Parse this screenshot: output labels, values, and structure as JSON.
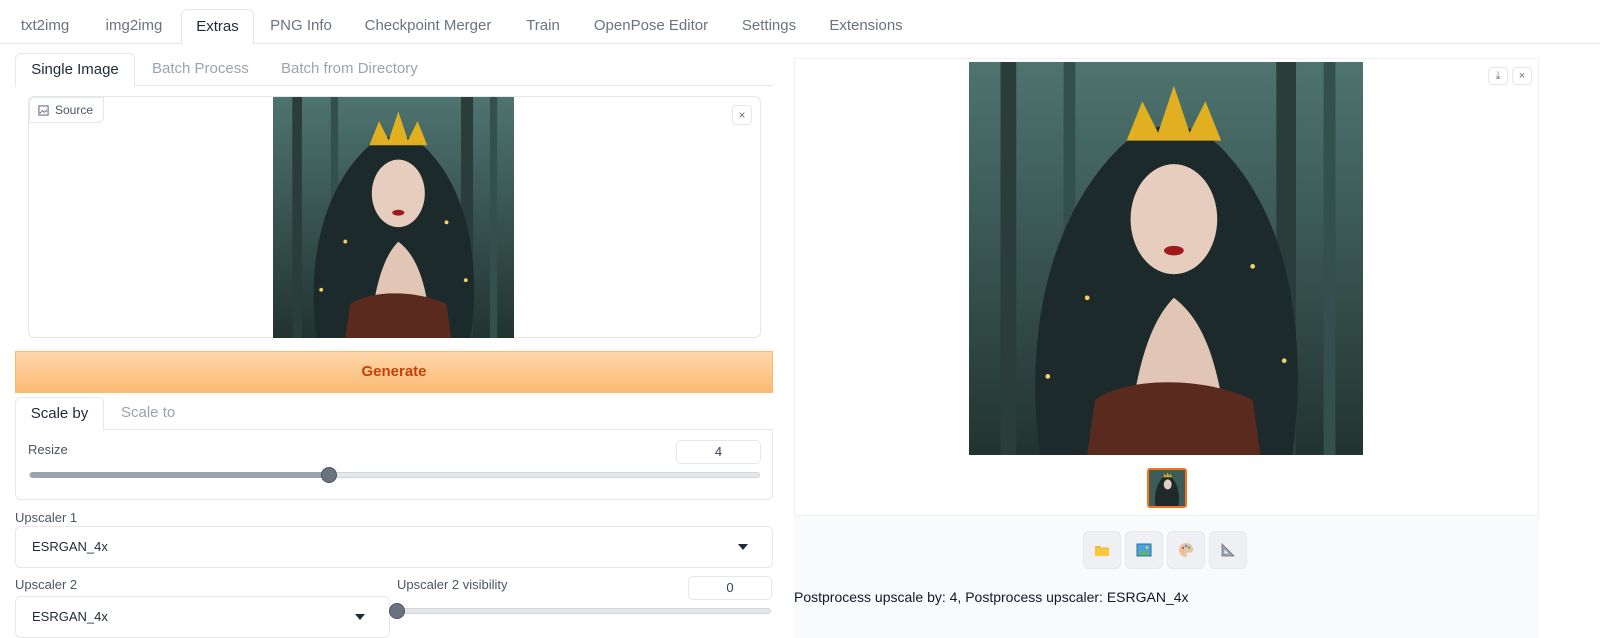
{
  "top_tabs": [
    "txt2img",
    "img2img",
    "Extras",
    "PNG Info",
    "Checkpoint Merger",
    "Train",
    "OpenPose Editor",
    "Settings",
    "Extensions"
  ],
  "active_top_tab": "Extras",
  "sub_tabs": [
    "Single Image",
    "Batch Process",
    "Batch from Directory"
  ],
  "source": {
    "label": "Source",
    "close": "×"
  },
  "generate_label": "Generate",
  "scale_tabs": [
    "Scale by",
    "Scale to"
  ],
  "resize": {
    "label": "Resize",
    "value": "4",
    "fraction": 0.41
  },
  "upscaler1": {
    "label": "Upscaler 1",
    "value": "ESRGAN_4x"
  },
  "upscaler2": {
    "label": "Upscaler 2",
    "value": "ESRGAN_4x"
  },
  "upscaler2_visibility": {
    "label": "Upscaler 2 visibility",
    "value": "0",
    "fraction": 0.0
  },
  "gallery": {
    "download": "⤓",
    "close": "×"
  },
  "actions": [
    "folder-icon",
    "image-icon",
    "palette-icon",
    "ruler-icon"
  ],
  "info_text": "Postprocess upscale by: 4, Postprocess upscaler: ESRGAN_4x",
  "colors": {
    "accent": "#f97316",
    "generate_bg": "#fdba74",
    "generate_text": "#c2410c"
  }
}
